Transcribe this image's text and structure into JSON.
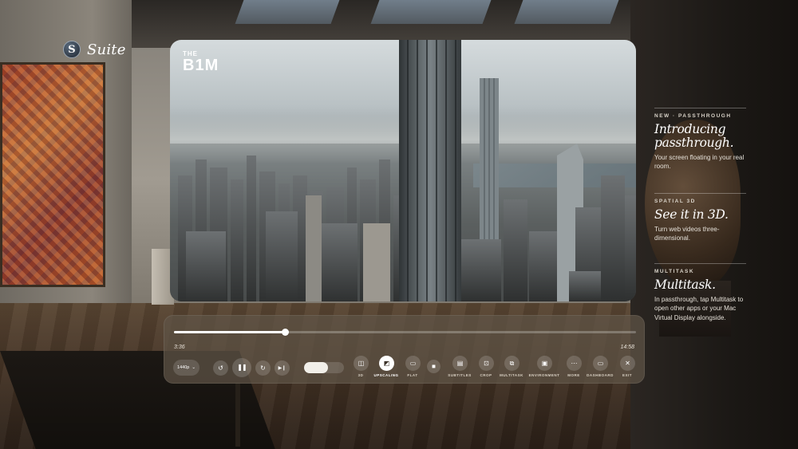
{
  "brand": {
    "badge_letter": "S",
    "name": "Suite"
  },
  "video": {
    "logo_small": "THE",
    "logo_large": "B1M"
  },
  "player": {
    "elapsed": "3:36",
    "total": "14:58",
    "progress": 0.24,
    "volume": 0.6,
    "quality": "1440p",
    "quality_chevron": "⌄",
    "buttons": {
      "rewind_icon": "↺",
      "pause_icon": "❚❚",
      "forward_icon": "↻",
      "next_icon": "▶❙",
      "threed_icon": "◫",
      "upscaling_icon": "◩",
      "flat_icon": "▭",
      "cinema_icon": "◼",
      "subtitles_icon": "▤",
      "crop_icon": "⊡",
      "multitask_icon": "⧉",
      "environment_icon": "▣",
      "more_icon": "⋯",
      "dashboard_icon": "▭",
      "exit_icon": "✕"
    },
    "labels": {
      "threed": "3D",
      "upscaling": "UPSCALING",
      "flat": "FLAT",
      "subtitles": "SUBTITLES",
      "crop": "CROP",
      "multitask": "MULTITASK",
      "environment": "ENVIRONMENT",
      "more": "MORE",
      "dashboard": "DASHBOARD",
      "exit": "EXIT"
    }
  },
  "info": [
    {
      "kicker": "NEW · PASSTHROUGH",
      "headline": "Introducing passthrough.",
      "desc": "Your screen floating in your real room."
    },
    {
      "kicker": "SPATIAL 3D",
      "headline": "See it in 3D.",
      "desc": "Turn web videos three-dimensional."
    },
    {
      "kicker": "MULTITASK",
      "headline": "Multitask.",
      "desc": "In passthrough, tap Multitask to open other apps or your Mac Virtual Display alongside."
    }
  ]
}
